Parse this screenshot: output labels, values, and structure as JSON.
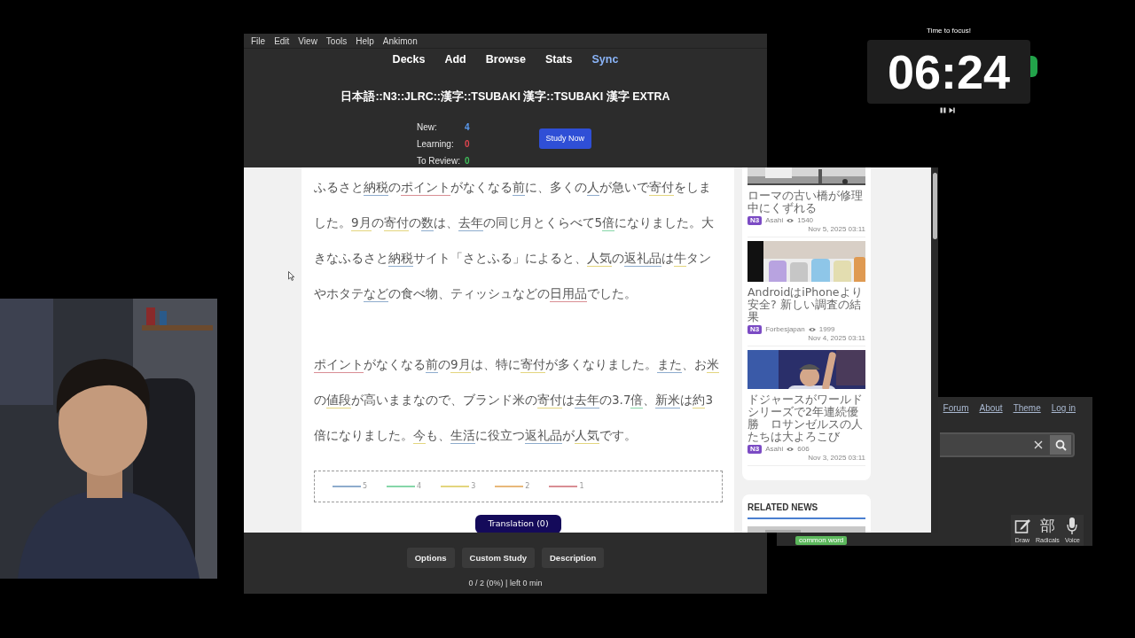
{
  "menu": [
    "File",
    "Edit",
    "View",
    "Tools",
    "Help",
    "Ankimon"
  ],
  "nav": [
    {
      "label": "Decks",
      "highlighted": false
    },
    {
      "label": "Add",
      "highlighted": false
    },
    {
      "label": "Browse",
      "highlighted": false
    },
    {
      "label": "Stats",
      "highlighted": false
    },
    {
      "label": "Sync",
      "highlighted": true
    }
  ],
  "deck_title": "日本語::N3::JLRC::漢字::TSUBAKI 漢字::TSUBAKI 漢字 EXTRA",
  "counts": [
    {
      "label": "New:",
      "value": "4",
      "color": "#5b9bf0"
    },
    {
      "label": "Learning:",
      "value": "0",
      "color": "#e0454f"
    },
    {
      "label": "To Review:",
      "value": "0",
      "color": "#3fbf5a"
    }
  ],
  "study_button": "Study Now",
  "article": {
    "paragraphs": [
      [
        {
          "text": "ふるさと"
        },
        {
          "text": "納税",
          "color": "#8eaccd"
        },
        {
          "text": "の"
        },
        {
          "text": "ポイント",
          "color": "#d98e94"
        },
        {
          "text": "がなくなる"
        },
        {
          "text": "前",
          "color": "#8eaccd"
        },
        {
          "text": "に、多くの"
        },
        {
          "text": "人",
          "color": "#8eaccd"
        },
        {
          "text": "が急いで"
        },
        {
          "text": "寄付",
          "color": "#e3d57e"
        },
        {
          "text": "をしました。"
        },
        {
          "text": "9月",
          "color": "#e3d57e"
        },
        {
          "text": "の"
        },
        {
          "text": "寄付",
          "color": "#e3d57e"
        },
        {
          "text": "の"
        },
        {
          "text": "数",
          "color": "#8eaccd"
        },
        {
          "text": "は、"
        },
        {
          "text": "去年",
          "color": "#8eaccd"
        },
        {
          "text": "の同じ月とくらべて5"
        },
        {
          "text": "倍",
          "color": "#86d6a8"
        },
        {
          "text": "になりました。大きなふるさと"
        },
        {
          "text": "納税",
          "color": "#8eaccd"
        },
        {
          "text": "サイト「さとふる」によると、"
        },
        {
          "text": "人気",
          "color": "#e3d57e"
        },
        {
          "text": "の"
        },
        {
          "text": "返礼品",
          "color": "#8eaccd"
        },
        {
          "text": "は"
        },
        {
          "text": "牛",
          "color": "#e3d57e"
        },
        {
          "text": "タンやホタテ"
        },
        {
          "text": "など",
          "color": "#8eaccd"
        },
        {
          "text": "の食べ物、ティッシュなどの"
        },
        {
          "text": "日用品",
          "color": "#d98e94"
        },
        {
          "text": "でした。"
        }
      ],
      [
        {
          "text": "ポイント",
          "color": "#d98e94"
        },
        {
          "text": "がなくなる"
        },
        {
          "text": "前",
          "color": "#8eaccd"
        },
        {
          "text": "の"
        },
        {
          "text": "9月",
          "color": "#e3d57e"
        },
        {
          "text": "は、特に"
        },
        {
          "text": "寄付",
          "color": "#e3d57e"
        },
        {
          "text": "が多くなりました。"
        },
        {
          "text": "また",
          "color": "#8eaccd"
        },
        {
          "text": "、お"
        },
        {
          "text": "米",
          "color": "#e3d57e"
        },
        {
          "text": "の"
        },
        {
          "text": "値段",
          "color": "#e3d57e"
        },
        {
          "text": "が高いままなので、ブランド米の"
        },
        {
          "text": "寄付",
          "color": "#e3d57e"
        },
        {
          "text": "は"
        },
        {
          "text": "去年",
          "color": "#8eaccd"
        },
        {
          "text": "の3.7"
        },
        {
          "text": "倍",
          "color": "#86d6a8"
        },
        {
          "text": "、"
        },
        {
          "text": "新米",
          "color": "#8eaccd"
        },
        {
          "text": "は"
        },
        {
          "text": "約",
          "color": "#e3d57e"
        },
        {
          "text": "3倍になりました。"
        },
        {
          "text": "今",
          "color": "#e3d57e"
        },
        {
          "text": "も、"
        },
        {
          "text": "生活",
          "color": "#8eaccd"
        },
        {
          "text": "に役立つ"
        },
        {
          "text": "返礼品",
          "color": "#8eaccd"
        },
        {
          "text": "が"
        },
        {
          "text": "人気",
          "color": "#e3d57e"
        },
        {
          "text": "です。"
        }
      ]
    ],
    "legend": [
      {
        "label": "5",
        "color": "#8eaccd"
      },
      {
        "label": "4",
        "color": "#86d6a8"
      },
      {
        "label": "3",
        "color": "#e3d57e"
      },
      {
        "label": "2",
        "color": "#e8b87a"
      },
      {
        "label": "1",
        "color": "#d98e94"
      }
    ],
    "translation_button": "Translation (0)"
  },
  "news": {
    "items": [
      {
        "title": "ローマの古い橋が修理中にくずれる",
        "badge": "N3",
        "source": "Asahi",
        "views": "1540",
        "date": "Nov 5, 2025 03:11"
      },
      {
        "title": "AndroidはiPhoneより安全? 新しい調査の結果",
        "badge": "N3",
        "source": "Forbesjapan",
        "views": "1999",
        "date": "Nov 4, 2025 03:11"
      },
      {
        "title": "ドジャースがワールドシリーズで2年連続優勝　ロサンゼルスの人たちは大よろこび",
        "badge": "N3",
        "source": "Asahi",
        "views": "606",
        "date": "Nov 3, 2025 03:11"
      }
    ],
    "related_heading": "RELATED NEWS"
  },
  "bottom_buttons": [
    "Options",
    "Custom Study",
    "Description"
  ],
  "progress": "0 / 2 (0%) | left 0 min",
  "timer": {
    "caption": "Time to focus!",
    "time": "06:24"
  },
  "dictionary": {
    "links": [
      "Forum",
      "About",
      "Theme",
      "Log in"
    ],
    "tag": "common word",
    "tools": [
      {
        "kind": "draw",
        "label": "Draw"
      },
      {
        "kind": "radicals",
        "label": "Radicals",
        "glyph": "部"
      },
      {
        "kind": "voice",
        "label": "Voice"
      }
    ]
  }
}
